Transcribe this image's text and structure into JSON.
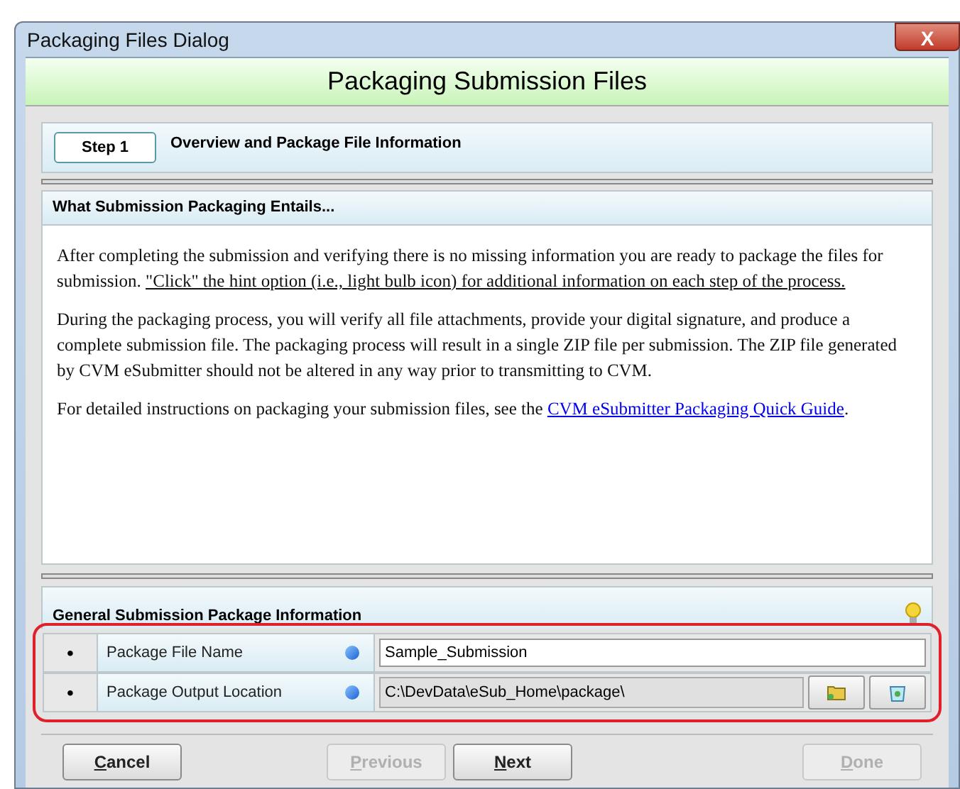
{
  "window": {
    "title": "Packaging Files Dialog",
    "close_label": "X"
  },
  "header": {
    "title": "Packaging Submission Files"
  },
  "step": {
    "badge": "Step 1",
    "title": "Overview and Package File Information"
  },
  "overview": {
    "title": "What Submission Packaging Entails...",
    "paragraphs": [
      [
        {
          "kind": "plain",
          "text": "After completing the submission and verifying there is no missing information you are ready to package the files for submission. "
        },
        {
          "kind": "underline",
          "text": "\"Click\" the hint option (i.e., light bulb icon) for additional information on each step of the process."
        }
      ],
      [
        {
          "kind": "plain",
          "text": "During the packaging process, you will verify all file attachments, provide your digital signature, and produce a complete submission file. The packaging process will result in a single ZIP file per submission. The ZIP file generated by CVM eSubmitter should not be altered in any way prior to transmitting to CVM."
        }
      ],
      [
        {
          "kind": "plain",
          "text": "For detailed instructions on packaging your submission files, see the "
        },
        {
          "kind": "link",
          "text": "CVM eSubmitter Packaging Quick Guide"
        },
        {
          "kind": "plain",
          "text": "."
        }
      ]
    ]
  },
  "general": {
    "title": "General Submission Package Information",
    "rows": [
      {
        "kind": "text",
        "bullet": "•",
        "label": "Package File Name",
        "value": "Sample_Submission"
      },
      {
        "kind": "path",
        "bullet": "•",
        "label": "Package Output Location",
        "value": "C:\\DevData\\eSub_Home\\package\\"
      }
    ]
  },
  "footer": {
    "left": [
      {
        "label": "Cancel",
        "disabled": false
      }
    ],
    "middle": [
      {
        "label": "Previous",
        "disabled": true
      },
      {
        "label": "Next",
        "disabled": false
      }
    ],
    "right": [
      {
        "label": "Done",
        "disabled": true
      }
    ]
  }
}
